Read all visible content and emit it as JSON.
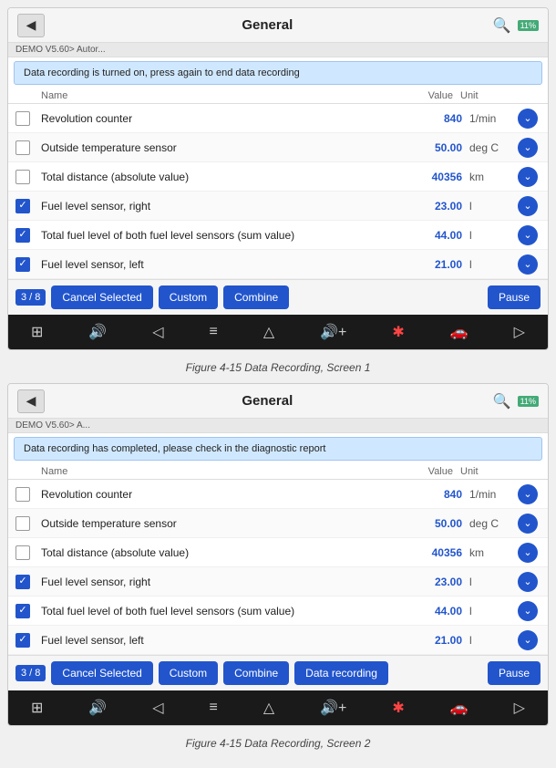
{
  "screens": [
    {
      "id": "screen1",
      "header": {
        "title": "General",
        "back_label": "◀",
        "search_icon": "🔍",
        "battery": "11%"
      },
      "demo_bar": "DEMO V5.60> Autor...",
      "notification": "Data recording is turned on, press again to end data recording",
      "table": {
        "columns": [
          "Name",
          "Value",
          "Unit"
        ],
        "rows": [
          {
            "checked": false,
            "name": "Revolution counter",
            "value": "840",
            "unit": "1/min",
            "has_chevron": true
          },
          {
            "checked": false,
            "name": "Outside temperature sensor",
            "value": "50.00",
            "unit": "deg C",
            "has_chevron": true
          },
          {
            "checked": false,
            "name": "Total distance (absolute value)",
            "value": "40356",
            "unit": "km",
            "has_chevron": true
          },
          {
            "checked": true,
            "name": "Fuel level sensor, right",
            "value": "23.00",
            "unit": "l",
            "has_chevron": true
          },
          {
            "checked": true,
            "name": "Total fuel level of both fuel level sensors (sum value)",
            "value": "44.00",
            "unit": "l",
            "has_chevron": true
          },
          {
            "checked": true,
            "name": "Fuel level sensor, left",
            "value": "21.00",
            "unit": "l",
            "has_chevron": true
          }
        ]
      },
      "toolbar": {
        "page": "3 / 8",
        "cancel_selected": "Cancel Selected",
        "custom": "Custom",
        "combine": "Combine",
        "pause": "Pause"
      }
    },
    {
      "id": "screen2",
      "header": {
        "title": "General",
        "back_label": "◀",
        "search_icon": "🔍",
        "battery": "11%"
      },
      "demo_bar": "DEMO V5.60> A...",
      "notification": "Data recording has completed, please check in the diagnostic report",
      "table": {
        "columns": [
          "Name",
          "Value",
          "Unit"
        ],
        "rows": [
          {
            "checked": false,
            "name": "Revolution counter",
            "value": "840",
            "unit": "1/min",
            "has_chevron": true
          },
          {
            "checked": false,
            "name": "Outside temperature sensor",
            "value": "50.00",
            "unit": "deg C",
            "has_chevron": true
          },
          {
            "checked": false,
            "name": "Total distance (absolute value)",
            "value": "40356",
            "unit": "km",
            "has_chevron": true
          },
          {
            "checked": true,
            "name": "Fuel level sensor, right",
            "value": "23.00",
            "unit": "l",
            "has_chevron": true
          },
          {
            "checked": true,
            "name": "Total fuel level of both fuel level sensors (sum value)",
            "value": "44.00",
            "unit": "l",
            "has_chevron": true
          },
          {
            "checked": true,
            "name": "Fuel level sensor, left",
            "value": "21.00",
            "unit": "l",
            "has_chevron": true
          }
        ]
      },
      "toolbar": {
        "page": "3 / 8",
        "cancel_selected": "Cancel Selected",
        "custom": "Custom",
        "combine": "Combine",
        "data_recording": "Data recording",
        "pause": "Pause"
      }
    }
  ],
  "captions": [
    "Figure 4-15 Data Recording, Screen 1",
    "Figure 4-15 Data Recording, Screen 2"
  ],
  "nav_icons": [
    "⊞",
    "🔊",
    "◁",
    "≡",
    "△",
    "🔊+",
    "✱",
    "🚗",
    "▷"
  ]
}
